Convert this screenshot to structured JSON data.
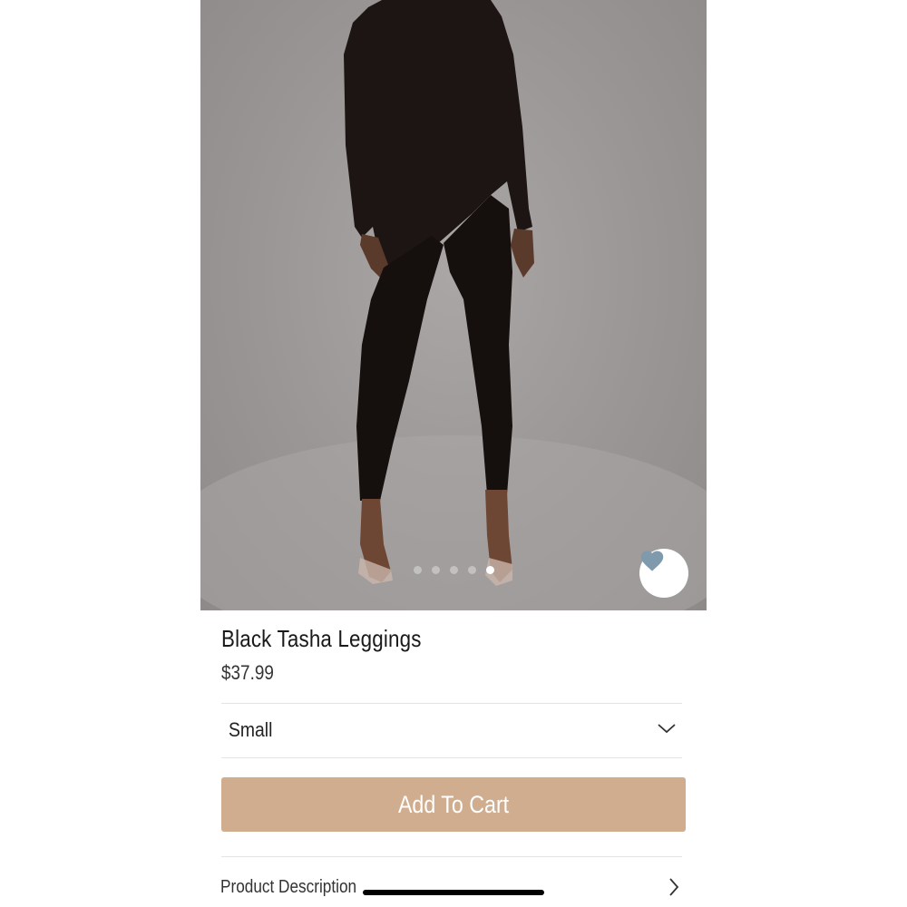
{
  "product": {
    "name": "Black Tasha Leggings",
    "price": "$37.99"
  },
  "gallery": {
    "image_count": 5,
    "active_index": 4
  },
  "size_select": {
    "selected": "Small",
    "icon": "chevron-down-icon"
  },
  "cart": {
    "label": "Add To Cart",
    "color": "#cfad8e"
  },
  "description": {
    "label": "Product Description",
    "icon": "chevron-right-icon"
  },
  "favorite": {
    "icon": "heart-icon",
    "color": "#7f99ad"
  }
}
